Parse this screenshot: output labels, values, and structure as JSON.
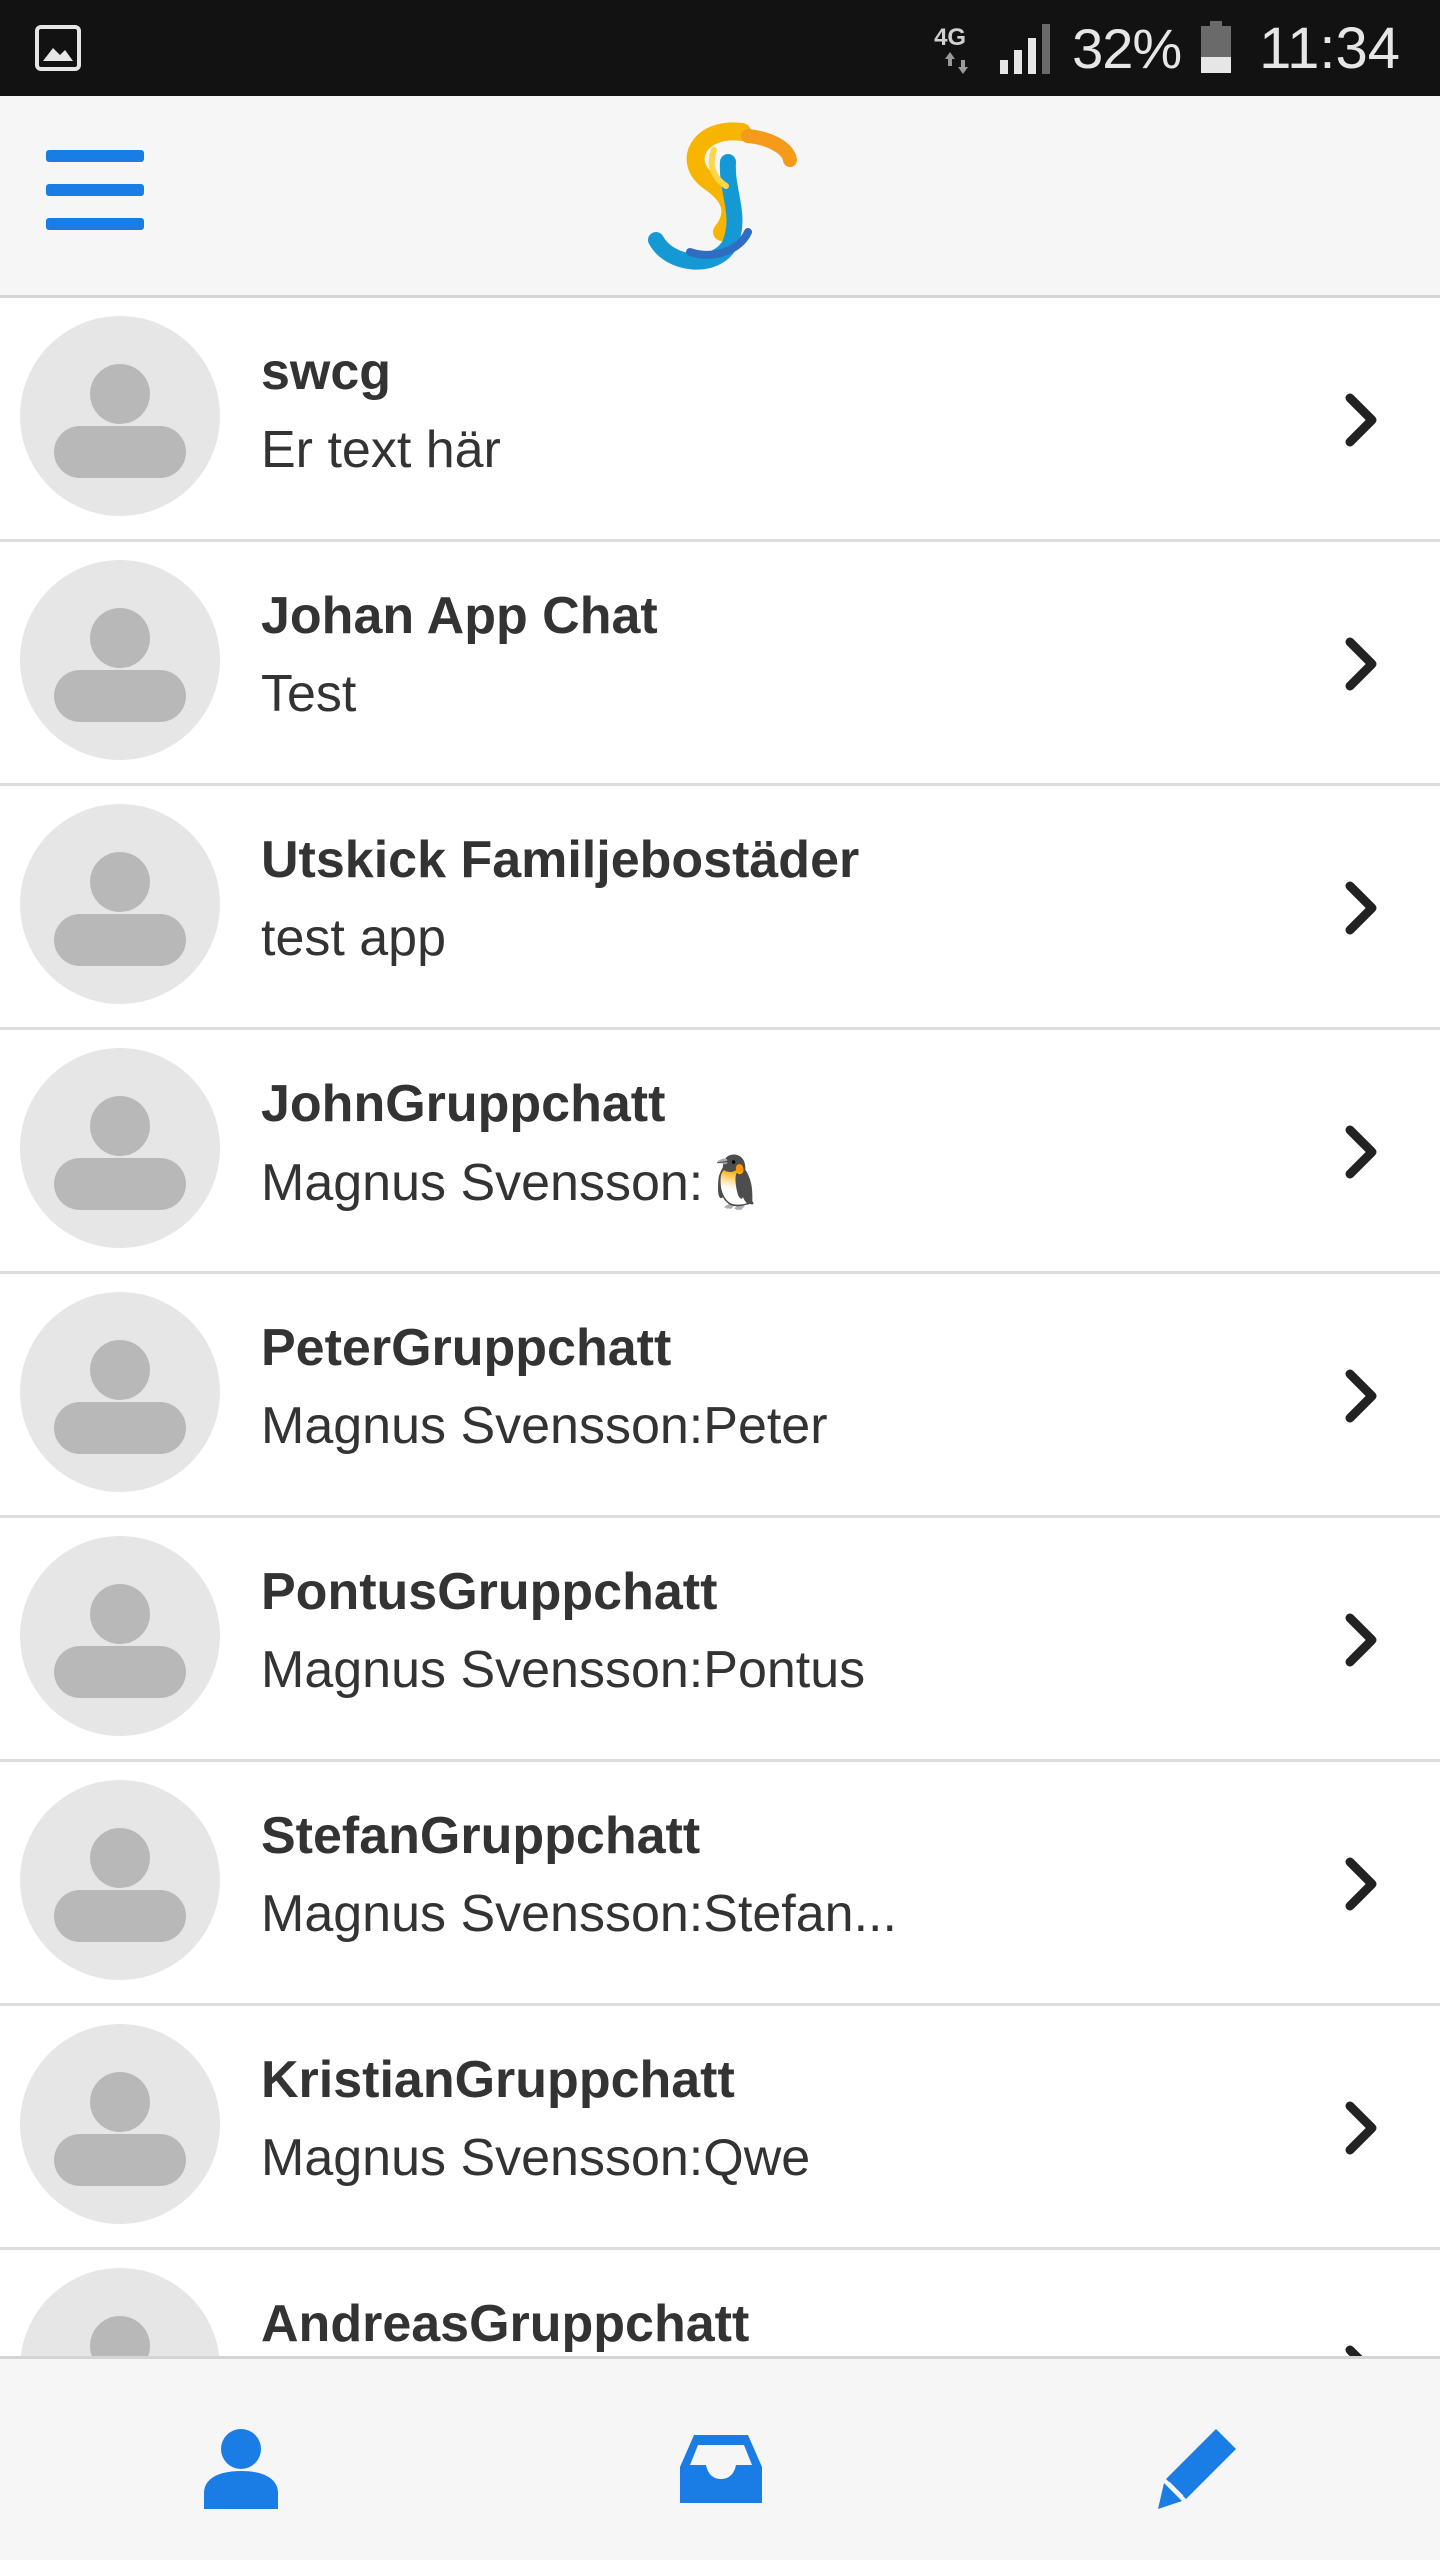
{
  "status_bar": {
    "network": "4G",
    "battery": "32%",
    "time": "11:34",
    "icons": [
      "gallery-icon",
      "signal-icon",
      "battery-icon"
    ]
  },
  "header": {
    "menu_icon": "hamburger-menu-icon",
    "logo": "app-logo"
  },
  "colors": {
    "accent": "#1a7de6",
    "header_bg": "#f6f6f6",
    "avatar_bg": "#e6e6e6",
    "avatar_fg": "#b8b8b8",
    "text": "#333333"
  },
  "chats": [
    {
      "title": "swcg",
      "preview": "Er text här"
    },
    {
      "title": "Johan App Chat",
      "preview": "Test"
    },
    {
      "title": "Utskick Familjebostäder",
      "preview": "test app"
    },
    {
      "title": "JohnGruppchatt",
      "preview": "Magnus Svensson:🐧"
    },
    {
      "title": "PeterGruppchatt",
      "preview": "Magnus Svensson:Peter"
    },
    {
      "title": "PontusGruppchatt",
      "preview": "Magnus Svensson:Pontus"
    },
    {
      "title": "StefanGruppchatt",
      "preview": "Magnus Svensson:Stefan..."
    },
    {
      "title": "KristianGruppchatt",
      "preview": "Magnus Svensson:Qwe"
    },
    {
      "title": "AndreasGruppchatt",
      "preview": ""
    }
  ],
  "tabs": [
    {
      "icon": "person-icon"
    },
    {
      "icon": "inbox-icon"
    },
    {
      "icon": "pencil-icon"
    }
  ]
}
